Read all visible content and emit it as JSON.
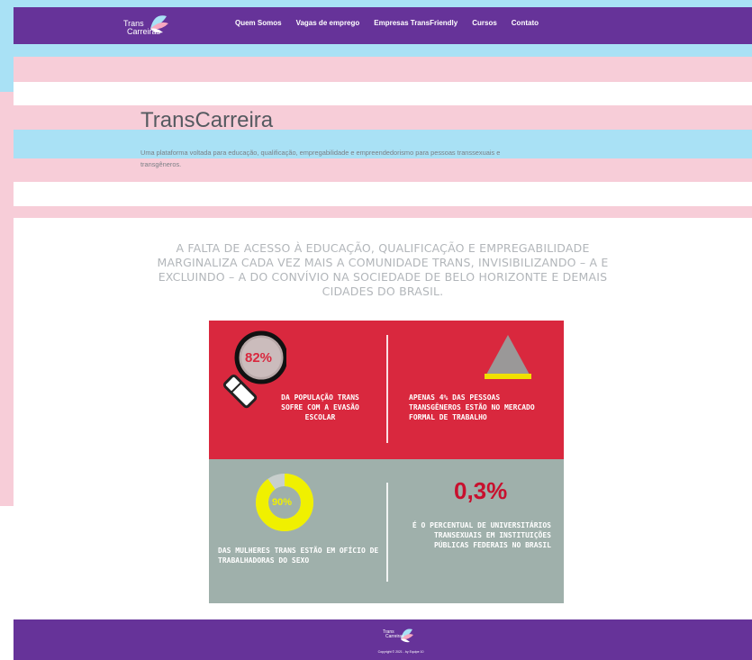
{
  "brand": {
    "line1": "Trans",
    "line2": "Carreiras"
  },
  "nav": {
    "items": [
      {
        "label": "Quem Somos"
      },
      {
        "label": "Vagas de emprego"
      },
      {
        "label": "Empresas TransFriendly"
      },
      {
        "label": "Cursos"
      },
      {
        "label": "Contato"
      }
    ]
  },
  "hero": {
    "title": "TransCarreira",
    "description": "Uma plataforma voltada para educação, qualificação, empregabilidade e empreendedorismo para pessoas transsexuais e transgêneros."
  },
  "intro": {
    "text": "A FALTA DE ACESSO À EDUCAÇÃO, QUALIFICAÇÃO E EMPREGABILIDADE MARGINALIZA CADA VEZ MAIS A COMUNIDADE TRANS, INVISIBILIZANDO – A E EXCLUINDO – A DO CONVÍVIO NA SOCIEDADE DE BELO HORIZONTE E DEMAIS CIDADES DO BRASIL."
  },
  "infographic": {
    "stat1": {
      "value": "82%",
      "text": "DA POPULAÇÃO TRANS SOFRE COM A EVASÃO ESCOLAR"
    },
    "stat2": {
      "text": "APENAS 4% DAS PESSOAS TRANSGÊNEROS ESTÃO NO MERCADO FORMAL DE TRABALHO"
    },
    "stat3": {
      "value": "90%",
      "fraction": 0.9,
      "text": "DAS MULHERES TRANS ESTÃO EM OFÍCIO DE TRABALHADORAS DO SEXO"
    },
    "stat4": {
      "value": "0,3%",
      "text": "É O PERCENTUAL DE UNIVERSITÁRIOS TRANSEXUAIS EM INSTITUIÇÕES PÚBLICAS FEDERAIS NO BRASIL"
    }
  },
  "footer": {
    "logo_line1": "Trans",
    "logo_line2": "Carreiras",
    "copyright": "Copyright © 2021 - by Equipe 10"
  },
  "colors": {
    "purple": "#663399",
    "trans_blue": "#a9e1f5",
    "trans_pink": "#f7cdd8",
    "info_red": "#d9283e",
    "info_grey": "#9fb0ab",
    "donut_yellow": "#f0f000"
  }
}
